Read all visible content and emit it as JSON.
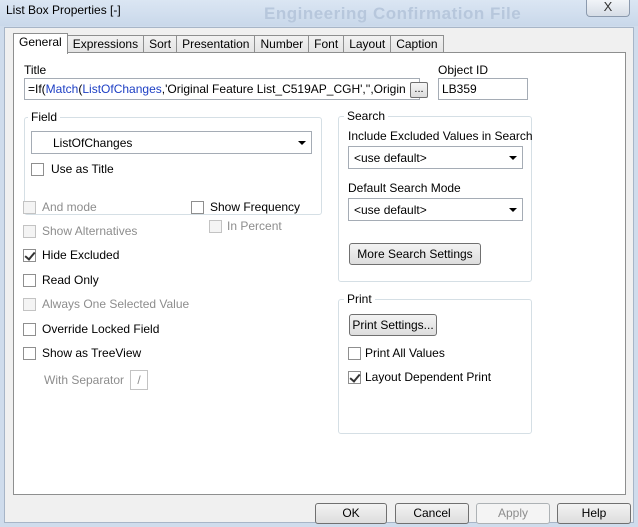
{
  "window": {
    "title": "List Box Properties [-]",
    "background_title": "Engineering Confirmation File",
    "close_glyph": "X"
  },
  "tabs": [
    {
      "label": "General",
      "active": true
    },
    {
      "label": "Expressions"
    },
    {
      "label": "Sort"
    },
    {
      "label": "Presentation"
    },
    {
      "label": "Number"
    },
    {
      "label": "Font"
    },
    {
      "label": "Layout"
    },
    {
      "label": "Caption"
    }
  ],
  "general": {
    "title_label": "Title",
    "title_value": {
      "prefix": "=If(",
      "fn": "Match",
      "open": "(",
      "field": "ListOfChanges",
      "rest": ",'Original Feature List_C519AP_CGH','',Origin"
    },
    "ellipsis_label": "...",
    "object_id_label": "Object ID",
    "object_id_value": "LB359",
    "field_group_label": "Field",
    "field_value": "ListOfChanges",
    "use_as_title": {
      "label": "Use as Title",
      "checked": false
    },
    "and_mode": {
      "label": "And mode",
      "checked": false,
      "enabled": false
    },
    "show_alternatives": {
      "label": "Show Alternatives",
      "checked": false,
      "enabled": false
    },
    "hide_excluded": {
      "label": "Hide Excluded",
      "checked": true,
      "enabled": true
    },
    "read_only": {
      "label": "Read Only",
      "checked": false,
      "enabled": true
    },
    "always_one_selected": {
      "label": "Always One Selected Value",
      "checked": false,
      "enabled": false
    },
    "override_locked": {
      "label": "Override Locked Field",
      "checked": false,
      "enabled": true
    },
    "show_as_treeview": {
      "label": "Show as TreeView",
      "checked": false,
      "enabled": true
    },
    "with_separator": {
      "label": "With Separator",
      "value": "/"
    },
    "show_frequency": {
      "label": "Show Frequency",
      "checked": false,
      "enabled": true
    },
    "in_percent": {
      "label": "In Percent",
      "checked": false,
      "enabled": false
    }
  },
  "search": {
    "group_label": "Search",
    "include_excluded_label": "Include Excluded Values in Search",
    "include_excluded_value": "<use default>",
    "default_mode_label": "Default Search Mode",
    "default_mode_value": "<use default>",
    "more_button": "More Search Settings"
  },
  "print": {
    "group_label": "Print",
    "settings_button": "Print Settings...",
    "print_all_values": {
      "label": "Print All Values",
      "checked": false
    },
    "layout_dependent": {
      "label": "Layout Dependent Print",
      "checked": true
    }
  },
  "buttons": {
    "ok": "OK",
    "cancel": "Cancel",
    "apply": "Apply",
    "help": "Help"
  }
}
